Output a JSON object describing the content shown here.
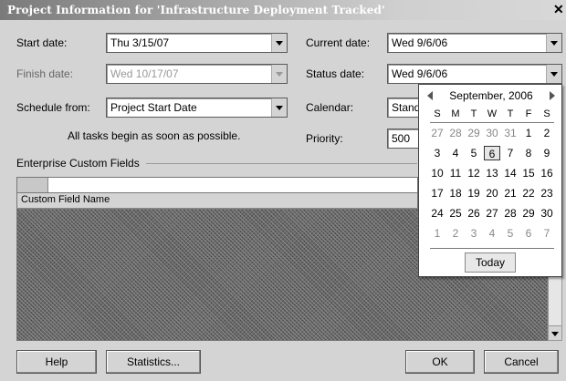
{
  "window": {
    "title": "Project Information for 'Infrastructure Deployment Tracked'",
    "close_glyph": "✕"
  },
  "fields": {
    "start_date": {
      "label": "Start date:",
      "value": "Thu 3/15/07"
    },
    "finish_date": {
      "label": "Finish date:",
      "value": "Wed 10/17/07"
    },
    "schedule_from": {
      "label": "Schedule from:",
      "value": "Project Start Date"
    },
    "current_date": {
      "label": "Current date:",
      "value": "Wed 9/6/06"
    },
    "status_date": {
      "label": "Status date:",
      "value": "Wed 9/6/06"
    },
    "calendar": {
      "label": "Calendar:",
      "value": "Standard"
    },
    "priority": {
      "label": "Priority:",
      "value": "500"
    }
  },
  "note": "All tasks begin as soon as possible.",
  "enterprise": {
    "section_label": "Enterprise Custom Fields",
    "column_header": "Custom Field Name"
  },
  "buttons": {
    "help": "Help",
    "statistics": "Statistics...",
    "ok": "OK",
    "cancel": "Cancel"
  },
  "calendar_popup": {
    "month_label": "September, 2006",
    "weekdays": [
      "S",
      "M",
      "T",
      "W",
      "T",
      "F",
      "S"
    ],
    "weeks": [
      [
        "27",
        "28",
        "29",
        "30",
        "31",
        "1",
        "2"
      ],
      [
        "3",
        "4",
        "5",
        "6",
        "7",
        "8",
        "9"
      ],
      [
        "10",
        "11",
        "12",
        "13",
        "14",
        "15",
        "16"
      ],
      [
        "17",
        "18",
        "19",
        "20",
        "21",
        "22",
        "23"
      ],
      [
        "24",
        "25",
        "26",
        "27",
        "28",
        "29",
        "30"
      ],
      [
        "1",
        "2",
        "3",
        "4",
        "5",
        "6",
        "7"
      ]
    ],
    "selected_day": "6",
    "today_label": "Today"
  }
}
